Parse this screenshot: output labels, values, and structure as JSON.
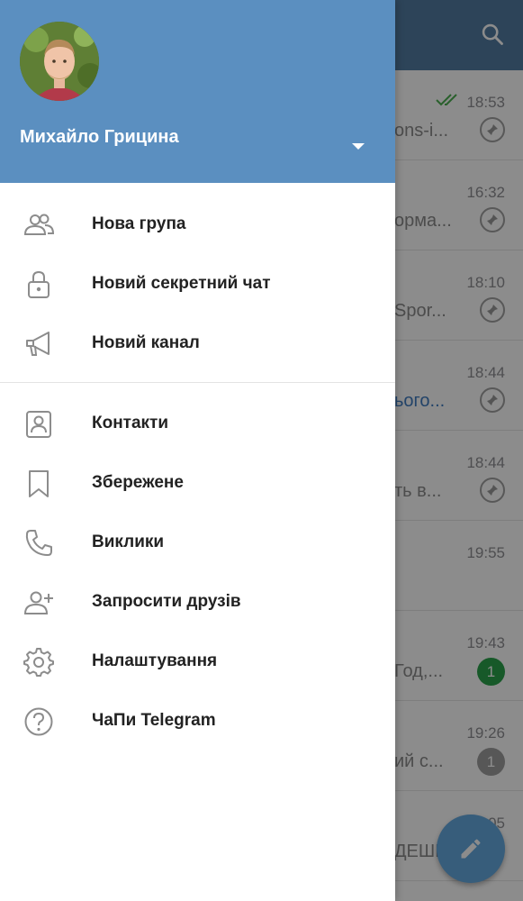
{
  "chats": [
    {
      "time": "18:53",
      "preview": "ons-i...",
      "pinned": true,
      "read": true
    },
    {
      "time": "16:32",
      "preview": "орма...",
      "pinned": true
    },
    {
      "time": "18:10",
      "preview": "Spor...",
      "pinned": true
    },
    {
      "time": "18:44",
      "preview": "ього...",
      "pinned": true,
      "preview_blue": true
    },
    {
      "time": "18:44",
      "preview": "ть в...",
      "pinned": true
    },
    {
      "time": "19:55",
      "preview": "",
      "pinned": false
    },
    {
      "time": "19:43",
      "preview": "Год,...",
      "badge": "1",
      "badge_color": "#2ba24c"
    },
    {
      "time": "19:26",
      "preview": "ий с...",
      "badge": "1",
      "badge_color": "#9e9e9e"
    },
    {
      "time": "0:05",
      "preview": "ДЕШЕ",
      "pinned": false
    }
  ],
  "drawer": {
    "user_name": "Михайло Грицина",
    "menu": [
      {
        "label": "Нова група",
        "icon": "group-icon"
      },
      {
        "label": "Новий секретний чат",
        "icon": "lock-icon"
      },
      {
        "label": "Новий канал",
        "icon": "megaphone-icon"
      },
      {
        "label": "Контакти",
        "icon": "contact-icon"
      },
      {
        "label": "Збережене",
        "icon": "bookmark-icon"
      },
      {
        "label": "Виклики",
        "icon": "phone-icon"
      },
      {
        "label": "Запросити друзів",
        "icon": "add-user-icon"
      },
      {
        "label": "Налаштування",
        "icon": "gear-icon"
      },
      {
        "label": "ЧаПи Telegram",
        "icon": "help-icon"
      }
    ]
  },
  "colors": {
    "header": "#5b8fc0",
    "topbar": "#527da3",
    "fab": "#65a9e0",
    "icon_gray": "#8c8c8c",
    "check_green": "#4caf50"
  }
}
